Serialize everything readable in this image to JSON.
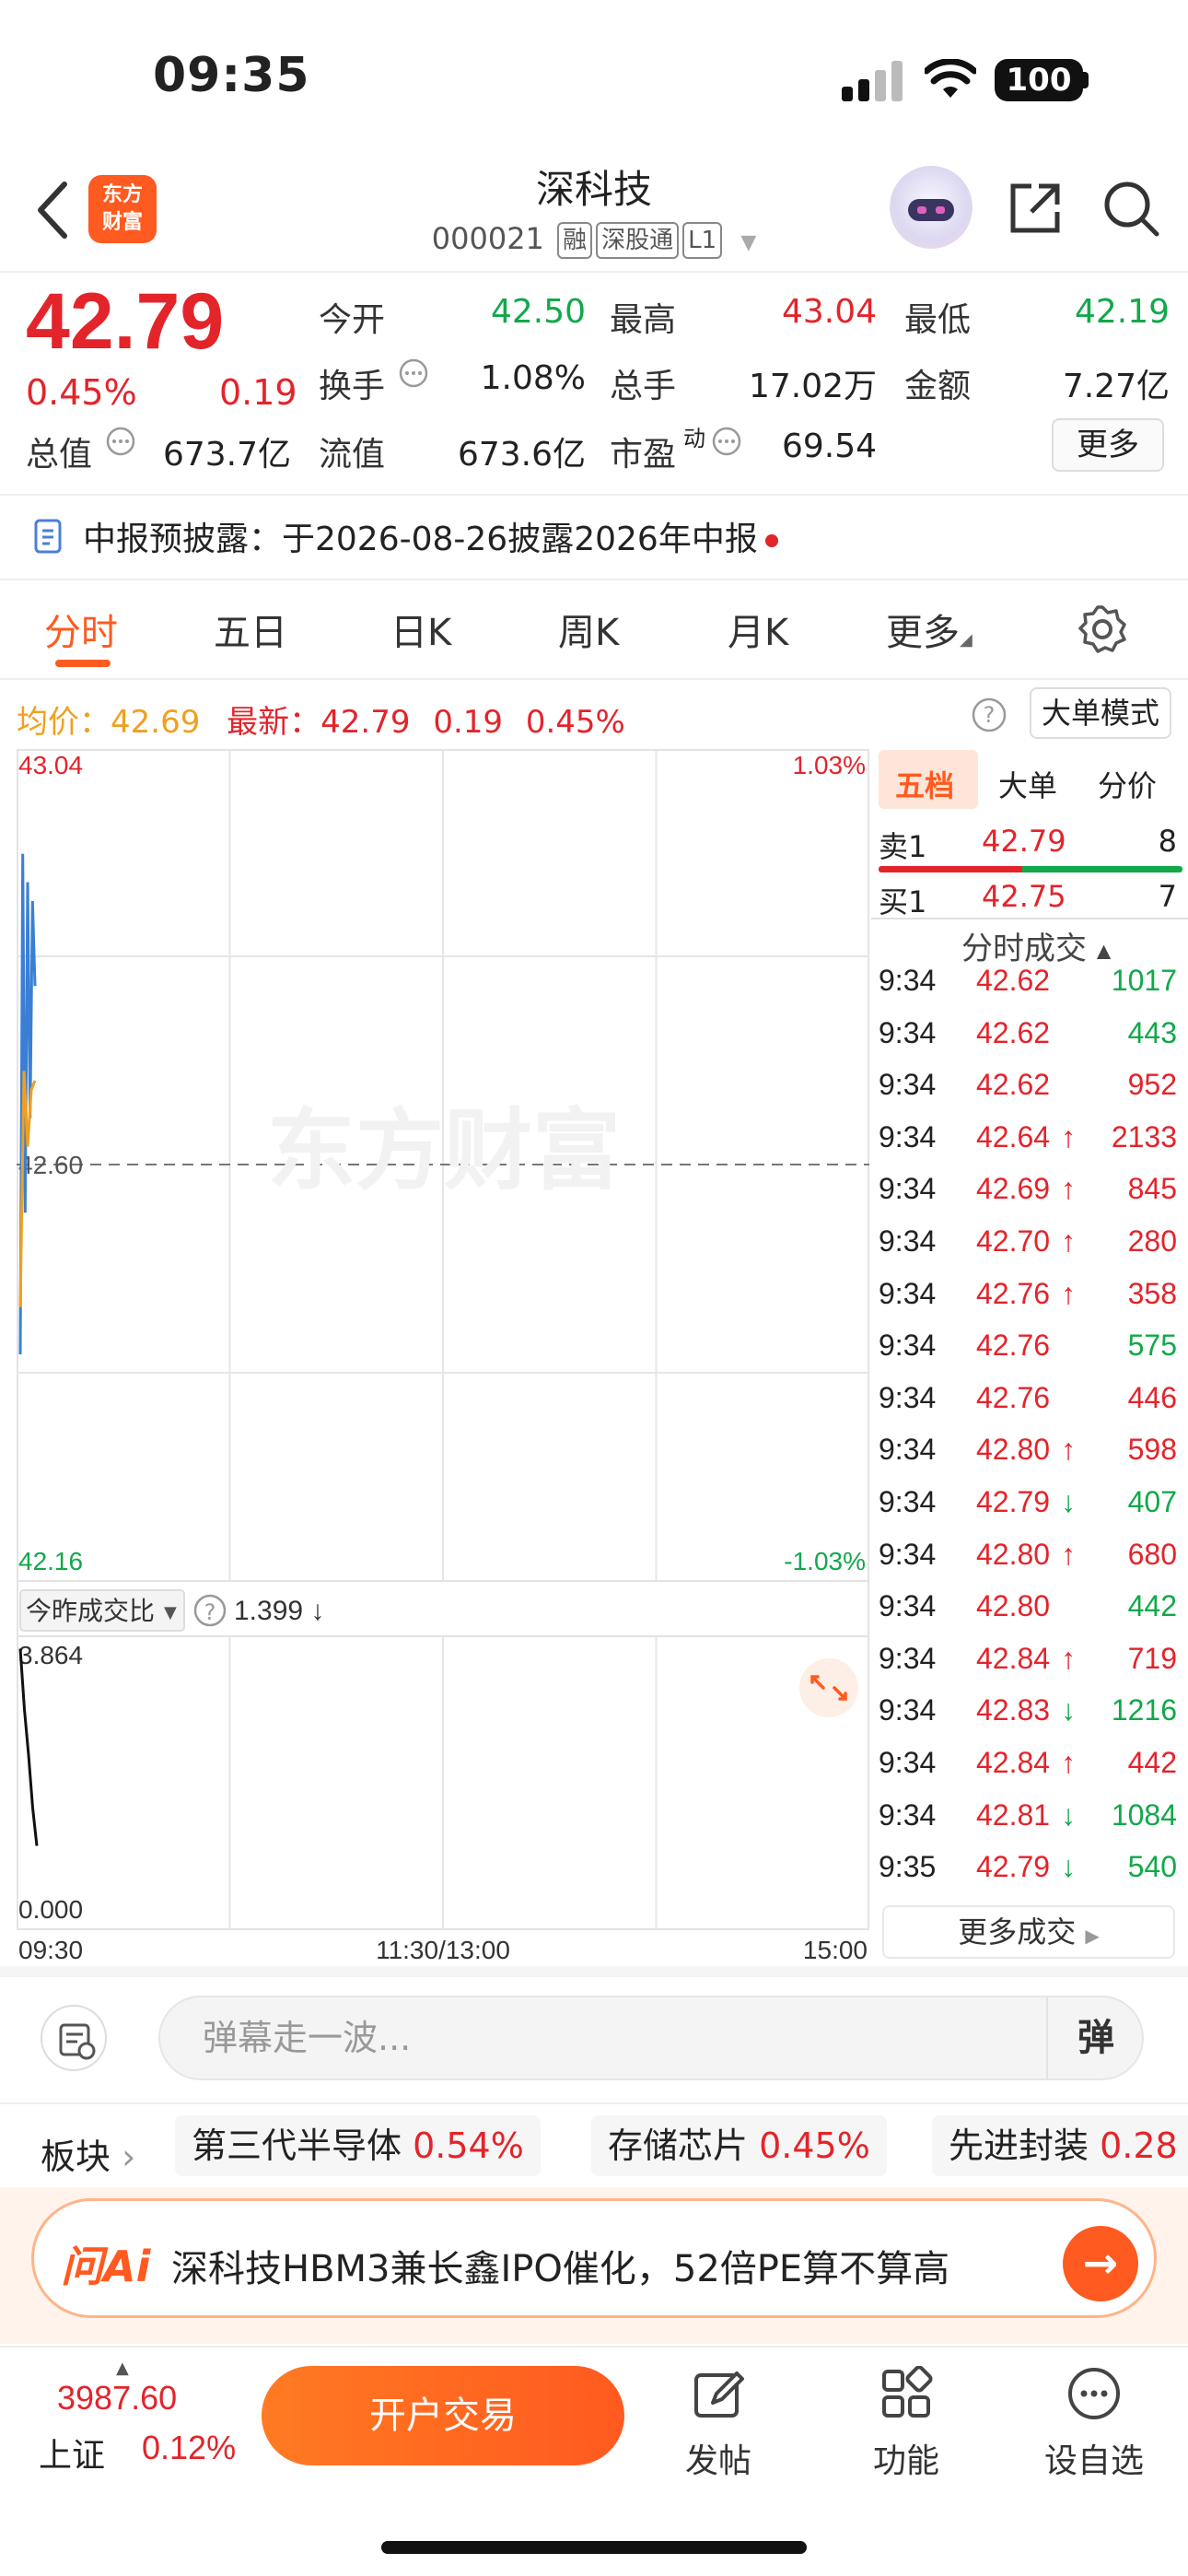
{
  "status_bar": {
    "time": "09:35",
    "battery": "100"
  },
  "header": {
    "logo_text": [
      "东方",
      "财富"
    ],
    "stock_name": "深科技",
    "stock_code": "000021",
    "tags": [
      "融",
      "深股通",
      "L1"
    ]
  },
  "quote": {
    "price": "42.79",
    "change_pct": "0.45%",
    "change_abs": "0.19",
    "fields": [
      {
        "label": "今开",
        "value": "42.50",
        "color": "green"
      },
      {
        "label": "最高",
        "value": "43.04",
        "color": "red"
      },
      {
        "label": "最低",
        "value": "42.19",
        "color": "green"
      },
      {
        "label": "换手",
        "value": "1.08%",
        "color": "dark"
      },
      {
        "label": "总手",
        "value": "17.02万",
        "color": "dark"
      },
      {
        "label": "金额",
        "value": "7.27亿",
        "color": "dark"
      },
      {
        "label": "总值",
        "value": "673.7亿",
        "color": "dark"
      },
      {
        "label": "流值",
        "value": "673.6亿",
        "color": "dark"
      },
      {
        "label": "市盈",
        "value": "69.54",
        "color": "dark"
      }
    ],
    "pe_superscript": "动",
    "more_label": "更多"
  },
  "notice": {
    "text": "中报预披露：于2026-08-26披露2026年中报"
  },
  "tabs": [
    "分时",
    "五日",
    "日K",
    "周K",
    "月K",
    "更多"
  ],
  "active_tab": 0,
  "info_row": {
    "avg_label": "均价：",
    "avg_value": "42.69",
    "latest_label": "最新：",
    "latest_value": "42.79",
    "latest_change": "0.19",
    "latest_pct": "0.45%",
    "big_order_label": "大单模式"
  },
  "chart_data": {
    "type": "line",
    "price_axis": {
      "max": "43.04",
      "mid": "42.60",
      "min": "42.16",
      "max_pct": "1.03%",
      "min_pct": "-1.03%"
    },
    "time_labels": [
      "09:30",
      "11:30/13:00",
      "15:00"
    ],
    "watermark": "东方财富",
    "series": [
      {
        "values": [
          42.4,
          42.93,
          42.55,
          42.9,
          42.65,
          42.88,
          42.79
        ]
      },
      {
        "values": [
          42.45,
          42.7,
          42.62,
          42.68,
          42.69
        ]
      }
    ],
    "volume_ratio": {
      "label": "今昨成交比",
      "value": "1.399 ↓",
      "max": "3.864",
      "min": "0.000",
      "values": [
        3.7,
        2.9,
        2.3,
        1.6,
        1.1
      ]
    }
  },
  "order_book": {
    "tabs": [
      "五档",
      "大单",
      "分价"
    ],
    "ask": {
      "label": "卖1",
      "price": "42.79",
      "qty": "8"
    },
    "bid": {
      "label": "买1",
      "price": "42.75",
      "qty": "7"
    },
    "trades_title": "分时成交",
    "trades": [
      {
        "t": "9:34",
        "p": "42.62",
        "arrow": "",
        "v": "1017",
        "vc": "green"
      },
      {
        "t": "9:34",
        "p": "42.62",
        "arrow": "",
        "v": "443",
        "vc": "green"
      },
      {
        "t": "9:34",
        "p": "42.62",
        "arrow": "",
        "v": "952",
        "vc": "red"
      },
      {
        "t": "9:34",
        "p": "42.64",
        "arrow": "↑",
        "v": "2133",
        "vc": "red"
      },
      {
        "t": "9:34",
        "p": "42.69",
        "arrow": "↑",
        "v": "845",
        "vc": "red"
      },
      {
        "t": "9:34",
        "p": "42.70",
        "arrow": "↑",
        "v": "280",
        "vc": "red"
      },
      {
        "t": "9:34",
        "p": "42.76",
        "arrow": "↑",
        "v": "358",
        "vc": "red"
      },
      {
        "t": "9:34",
        "p": "42.76",
        "arrow": "",
        "v": "575",
        "vc": "green"
      },
      {
        "t": "9:34",
        "p": "42.76",
        "arrow": "",
        "v": "446",
        "vc": "red"
      },
      {
        "t": "9:34",
        "p": "42.80",
        "arrow": "↑",
        "v": "598",
        "vc": "red"
      },
      {
        "t": "9:34",
        "p": "42.79",
        "arrow": "↓",
        "v": "407",
        "vc": "green"
      },
      {
        "t": "9:34",
        "p": "42.80",
        "arrow": "↑",
        "v": "680",
        "vc": "red"
      },
      {
        "t": "9:34",
        "p": "42.80",
        "arrow": "",
        "v": "442",
        "vc": "green"
      },
      {
        "t": "9:34",
        "p": "42.84",
        "arrow": "↑",
        "v": "719",
        "vc": "red"
      },
      {
        "t": "9:34",
        "p": "42.83",
        "arrow": "↓",
        "v": "1216",
        "vc": "green"
      },
      {
        "t": "9:34",
        "p": "42.84",
        "arrow": "↑",
        "v": "442",
        "vc": "red"
      },
      {
        "t": "9:34",
        "p": "42.81",
        "arrow": "↓",
        "v": "1084",
        "vc": "green"
      },
      {
        "t": "9:35",
        "p": "42.79",
        "arrow": "↓",
        "v": "540",
        "vc": "green"
      }
    ],
    "more_trades": "更多成交"
  },
  "comment": {
    "placeholder": "弹幕走一波...",
    "danmu": "弹"
  },
  "sectors": {
    "label": "板块",
    "items": [
      {
        "name": "第三代半导体",
        "pct": "0.54%"
      },
      {
        "name": "存储芯片",
        "pct": "0.45%"
      },
      {
        "name": "先进封装",
        "pct": "0.28"
      }
    ]
  },
  "ai_banner": {
    "logo": "问Ai",
    "text": "深科技HBM3兼长鑫IPO催化，52倍PE算不算高"
  },
  "bottom_bar": {
    "index_value": "3987.60",
    "index_name": "上证",
    "index_pct": "0.12%",
    "trade_button": "开户交易",
    "nav": [
      {
        "label": "发帖",
        "icon": "edit-icon"
      },
      {
        "label": "功能",
        "icon": "grid-icon"
      },
      {
        "label": "设自选",
        "icon": "more-icon"
      }
    ]
  },
  "colors": {
    "accent": "#ff5a1f",
    "up": "#e3242b",
    "down": "#12a84a",
    "avg": "#f0a020",
    "line": "#3a7fd4"
  }
}
